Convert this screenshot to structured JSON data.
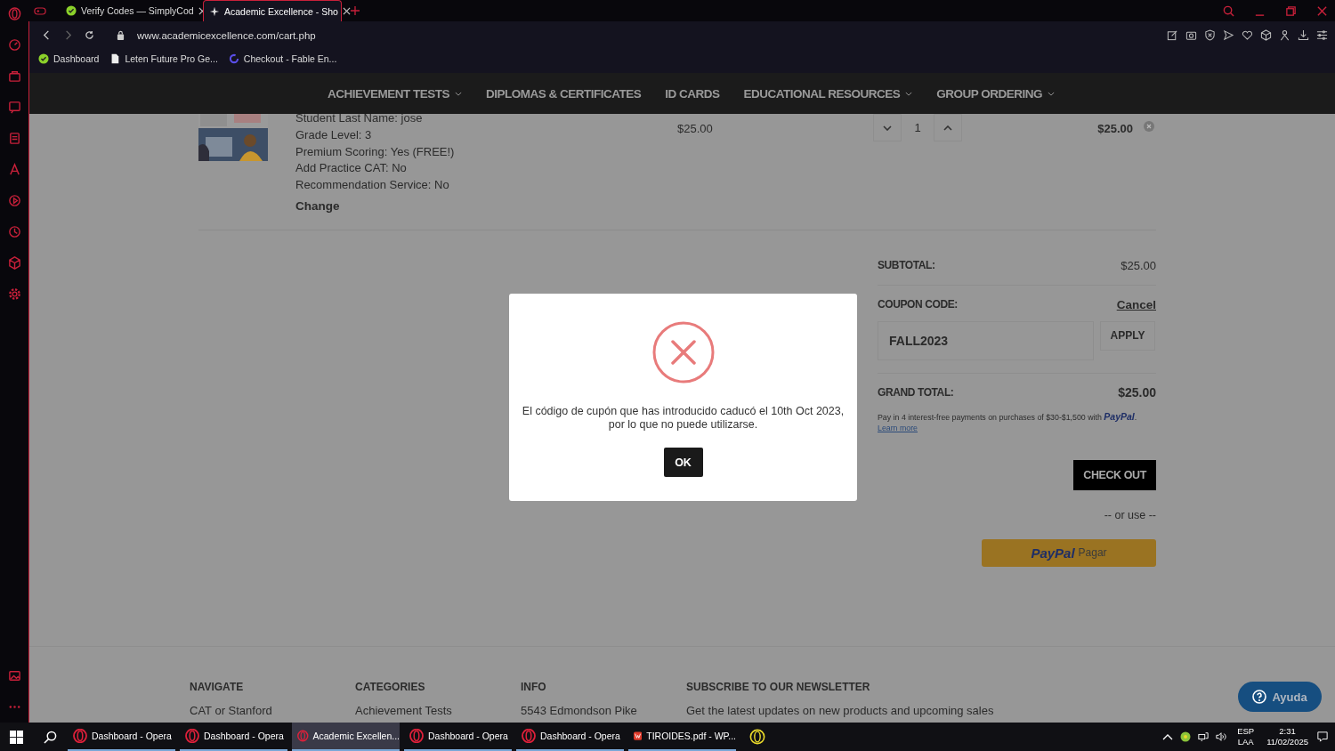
{
  "browser": {
    "tabs": [
      {
        "title": "Verify Codes — SimplyCod",
        "selected": false,
        "kind": "check"
      },
      {
        "title": "Academic Excellence - Sho",
        "selected": true,
        "kind": "spark"
      }
    ],
    "address": "www.academicexcellence.com/cart.php",
    "bookmarks": [
      {
        "label": "Dashboard",
        "kind": "check"
      },
      {
        "label": "Leten Future Pro Ge...",
        "kind": "page"
      },
      {
        "label": "Checkout - Fable En...",
        "kind": "ring"
      }
    ]
  },
  "site_nav": [
    {
      "label": "ACHIEVEMENT TESTS",
      "dropdown": true
    },
    {
      "label": "DIPLOMAS & CERTIFICATES",
      "dropdown": false
    },
    {
      "label": "ID CARDS",
      "dropdown": false
    },
    {
      "label": "EDUCATIONAL RESOURCES",
      "dropdown": true
    },
    {
      "label": "GROUP ORDERING",
      "dropdown": true
    }
  ],
  "cart_item": {
    "details": [
      "Student Last Name:  jose",
      "Grade Level:  3",
      "Premium Scoring:  Yes (FREE!)",
      "Add Practice CAT:  No",
      "Recommendation Service:  No"
    ],
    "change": "Change",
    "price": "$25.00",
    "quantity": "1",
    "total": "$25.00"
  },
  "summary": {
    "subtotal_label": "SUBTOTAL:",
    "subtotal": "$25.00",
    "coupon_label": "COUPON CODE:",
    "cancel": "Cancel",
    "coupon": "FALL2023",
    "apply": "APPLY",
    "grand_total_label": "GRAND TOTAL:",
    "grand_total": "$25.00",
    "paypal_note": "Pay in 4 interest-free payments on purchases of $30-$1,500 with",
    "paypal_logo": "PayPal",
    "paypal_note_end": ".",
    "learn_more": "Learn more",
    "checkout": "CHECK OUT",
    "or_use": "-- or use --",
    "paypal_button": {
      "logo": "PayPal",
      "label": "Pagar"
    }
  },
  "modal": {
    "lines": [
      "El código de cupón que has introducido caducó el 10th Oct 2023,",
      "por lo que no puede utilizarse."
    ],
    "ok": "OK"
  },
  "footer": {
    "columns": [
      {
        "heading": "NAVIGATE",
        "item": "CAT or Stanford"
      },
      {
        "heading": "CATEGORIES",
        "item": "Achievement Tests"
      },
      {
        "heading": "INFO",
        "item": "5543 Edmondson Pike"
      },
      {
        "heading": "SUBSCRIBE TO OUR NEWSLETTER",
        "item": "Get the latest updates on new products and upcoming sales"
      }
    ]
  },
  "help_button": "Ayuda",
  "taskbar": {
    "apps": [
      {
        "label": "Dashboard - Opera",
        "selected": false,
        "kind": "opera"
      },
      {
        "label": "Dashboard - Opera",
        "selected": false,
        "kind": "opera"
      },
      {
        "label": "Academic Excellen...",
        "selected": true,
        "kind": "opera"
      },
      {
        "label": "Dashboard - Opera",
        "selected": false,
        "kind": "opera"
      },
      {
        "label": "Dashboard - Opera",
        "selected": false,
        "kind": "opera"
      },
      {
        "label": "TIROIDES.pdf - WP...",
        "selected": false,
        "kind": "pdf"
      }
    ],
    "lang": "ESP",
    "region": "LAA",
    "time": "2:31",
    "date": "11/02/2025"
  }
}
